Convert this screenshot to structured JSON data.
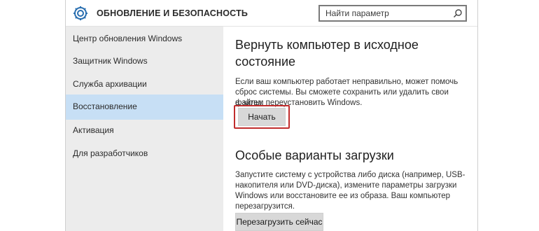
{
  "header": {
    "title": "ОБНОВЛЕНИЕ И БЕЗОПАСНОСТЬ",
    "search_placeholder": "Найти параметр"
  },
  "sidebar": {
    "items": [
      {
        "label": "Центр обновления Windows",
        "selected": false
      },
      {
        "label": "Защитник Windows",
        "selected": false
      },
      {
        "label": "Служба архивации",
        "selected": false
      },
      {
        "label": "Восстановление",
        "selected": true
      },
      {
        "label": "Активация",
        "selected": false
      },
      {
        "label": "Для разработчиков",
        "selected": false
      }
    ]
  },
  "reset": {
    "heading_line1": "Вернуть компьютер в исходное",
    "heading_line2": "состояние",
    "desc_line1": "Если ваш компьютер работает неправильно, может помочь",
    "desc_line2": "сброс системы. Вы сможете сохранить или удалить свои файлы,",
    "desc_line3": "а затем переустановить Windows.",
    "button": "Начать"
  },
  "advanced": {
    "heading": "Особые варианты загрузки",
    "desc_line1": "Запустите систему с устройства либо диска (например, USB-",
    "desc_line2": "накопителя или DVD-диска), измените параметры загрузки",
    "desc_line3": "Windows или восстановите ее из образа. Ваш компьютер",
    "desc_line4": "перезагрузится.",
    "button": "Перезагрузить сейчас"
  },
  "colors": {
    "selected_bg": "#c7dff5",
    "sidebar_bg": "#ececec",
    "highlight_border": "#c12d2d"
  }
}
